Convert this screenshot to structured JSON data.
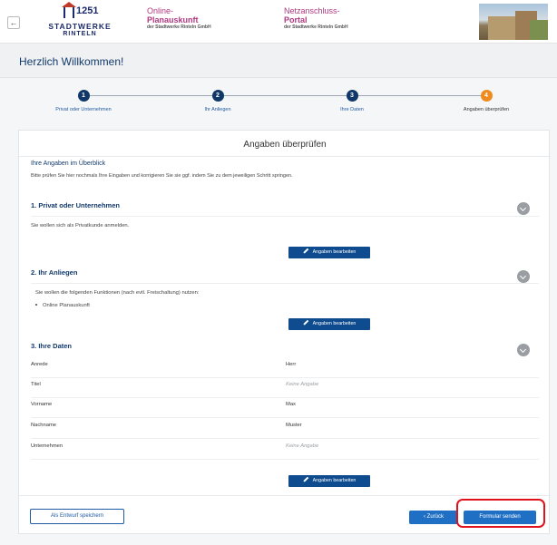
{
  "header": {
    "back_icon": "arrow-left-icon",
    "logo_number": "1251",
    "logo_line1": "STADTWERKE",
    "logo_line2": "RINTELN",
    "col1": {
      "line1": "Online-",
      "line2": "Planauskunft",
      "line3": "der Stadtwerke Rinteln GmbH"
    },
    "col2": {
      "line1": "Netzanschluss-",
      "line2": "Portal",
      "line3": "der Stadtwerke Rinteln GmbH"
    }
  },
  "welcome": {
    "title": "Herzlich Willkommen!"
  },
  "stepper": {
    "steps": [
      {
        "number": "1",
        "label": "Privat oder Unternehmen"
      },
      {
        "number": "2",
        "label": "Ihr Anliegen"
      },
      {
        "number": "3",
        "label": "Ihre Daten"
      },
      {
        "number": "4",
        "label": "Angaben überprüfen"
      }
    ],
    "active_step": 4
  },
  "card": {
    "title": "Angaben überprüfen",
    "overview_head": "Ihre Angaben im Überblick",
    "overview_text": "Bitte prüfen Sie hier nochmals Ihre Eingaben und korrigieren Sie sie ggf. indem Sie zu dem jeweiligen Schritt springen.",
    "section1": {
      "title": "1. Privat oder Unternehmen",
      "text": "Sie wollen sich als Privatkunde anmelden."
    },
    "section2": {
      "title": "2. Ihr Anliegen",
      "text": "Sie wollen die folgenden Funktionen (nach evtl. Freischaltung) nutzen:",
      "items": [
        "Online Planauskunft"
      ]
    },
    "section3": {
      "title": "3. Ihre Daten",
      "rows": [
        {
          "label": "Anrede",
          "value": "Herr",
          "empty": false
        },
        {
          "label": "Titel",
          "value": "Keine Angabe",
          "empty": true
        },
        {
          "label": "Vorname",
          "value": "Max",
          "empty": false
        },
        {
          "label": "Nachname",
          "value": "Muster",
          "empty": false
        },
        {
          "label": "Unternehmen",
          "value": "Keine Angabe",
          "empty": true
        }
      ]
    },
    "edit_label": "Angaben bearbeiten",
    "draft_label": "Als Entwurf speichern",
    "back_label": "‹ Zurück",
    "send_label": "Formular senden"
  },
  "colors": {
    "primary": "#0f3768",
    "accent": "#ef8a1f",
    "button": "#1f6fc5",
    "highlight": "#e0121c"
  }
}
